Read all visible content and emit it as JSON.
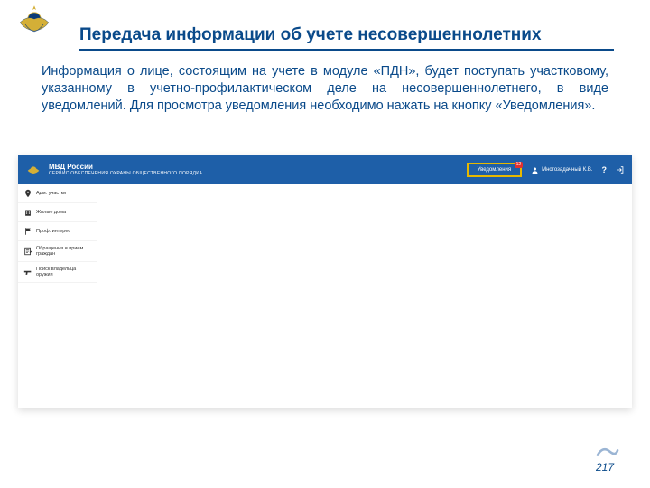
{
  "slide": {
    "title": "Передача информации об учете несовершеннолетних",
    "body": "Информация о лице, состоящим на учете в модуле «ПДН», будет поступать участковому, указанному в учетно-профилактическом деле на несовершеннолетнего, в виде уведомлений. Для просмотра уведомления необходимо нажать на кнопку «Уведомления».",
    "page_number": "217"
  },
  "app": {
    "topbar": {
      "brand_line1": "МВД России",
      "brand_line2": "СЕРВИС ОБЕСПЕЧЕНИЯ ОХРАНЫ ОБЩЕСТВЕННОГО ПОРЯДКА",
      "notifications_label": "Уведомления",
      "notifications_count": "12",
      "user_name": "Многозадачный К.В."
    },
    "sidebar": {
      "items": [
        {
          "label": "Адм. участки"
        },
        {
          "label": "Жилые дома"
        },
        {
          "label": "Проф. интерес"
        },
        {
          "label": "Обращения и прием граждан"
        },
        {
          "label": "Поиск владельца оружия"
        }
      ]
    }
  }
}
